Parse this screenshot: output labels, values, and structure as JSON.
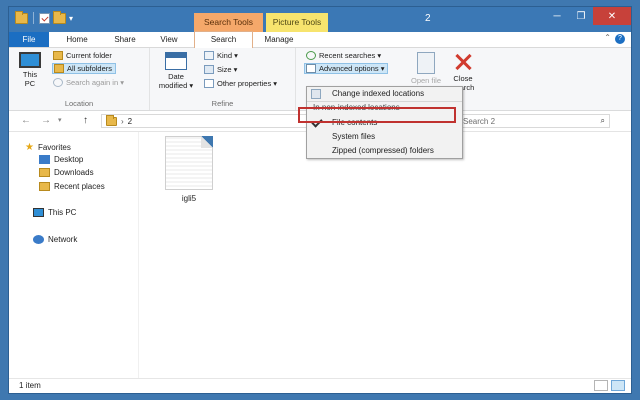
{
  "window": {
    "title": "2",
    "contextual_tabs": [
      "Search Tools",
      "Picture Tools"
    ],
    "controls": [
      "─",
      "❐",
      "✕"
    ]
  },
  "ribbon_tabs": [
    "File",
    "Home",
    "Share",
    "View",
    "Search",
    "Manage"
  ],
  "ribbon": {
    "location": {
      "label": "Location",
      "this_pc": "This PC",
      "current_folder": "Current folder",
      "all_subfolders": "All subfolders",
      "search_again": "Search again in ▾"
    },
    "refine": {
      "label": "Refine",
      "date_modified": "Date modified ▾",
      "kind": "Kind ▾",
      "size": "Size ▾",
      "other_properties": "Other properties ▾"
    },
    "options": {
      "recent_searches": "Recent searches ▾",
      "advanced_options": "Advanced options ▾",
      "open_file": "Open file",
      "close_search": "Close search"
    }
  },
  "dropdown": {
    "change_indexed": "Change indexed locations",
    "header": "In non-indexed locations",
    "items": [
      "File contents",
      "System files",
      "Zipped (compressed) folders"
    ],
    "checked_index": 0
  },
  "address": {
    "path": "2",
    "search_placeholder": "Search 2"
  },
  "nav": {
    "favorites": "Favorites",
    "desktop": "Desktop",
    "downloads": "Downloads",
    "recent_places": "Recent places",
    "this_pc": "This PC",
    "network": "Network"
  },
  "files": [
    {
      "name": "igli5"
    }
  ],
  "status": {
    "item_count": "1 item"
  },
  "colors": {
    "accent": "#3b78b5",
    "highlight_border": "#c0322f",
    "search_tools_tab": "#f5a86a",
    "picture_tools_tab": "#f7e46e"
  }
}
